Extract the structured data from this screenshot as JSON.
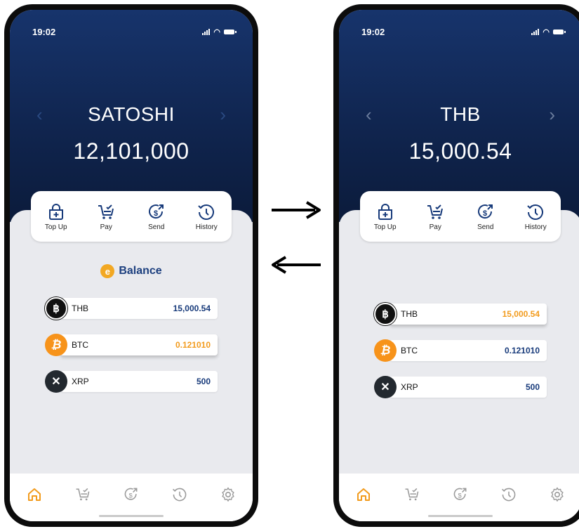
{
  "colors": {
    "navy": "#10254f",
    "accent": "#f29b1d",
    "value_blue": "#173a7a"
  },
  "screens": [
    {
      "status_time": "19:02",
      "currency": "SATOSHI",
      "amount": "12,101,000",
      "actions": [
        "Top Up",
        "Pay",
        "Send",
        "History"
      ],
      "balance_title": "Balance",
      "rows": [
        {
          "symbol": "THB",
          "value": "15,000.54",
          "icon": "baht-coin-icon"
        },
        {
          "symbol": "BTC",
          "value": "0.121010",
          "icon": "bitcoin-icon"
        },
        {
          "symbol": "XRP",
          "value": "500",
          "icon": "xrp-icon"
        }
      ]
    },
    {
      "status_time": "19:02",
      "currency": "THB",
      "amount": "15,000.54",
      "actions": [
        "Top Up",
        "Pay",
        "Send",
        "History"
      ],
      "rows": [
        {
          "symbol": "THB",
          "value": "15,000.54",
          "icon": "baht-coin-icon"
        },
        {
          "symbol": "BTC",
          "value": "0.121010",
          "icon": "bitcoin-icon"
        },
        {
          "symbol": "XRP",
          "value": "500",
          "icon": "xrp-icon"
        }
      ]
    }
  ],
  "tabbar_icons": [
    "home-icon",
    "cart-icon",
    "send-icon",
    "history-icon",
    "settings-icon"
  ],
  "transition_arrows": [
    "arrow-right-icon",
    "arrow-left-icon"
  ]
}
